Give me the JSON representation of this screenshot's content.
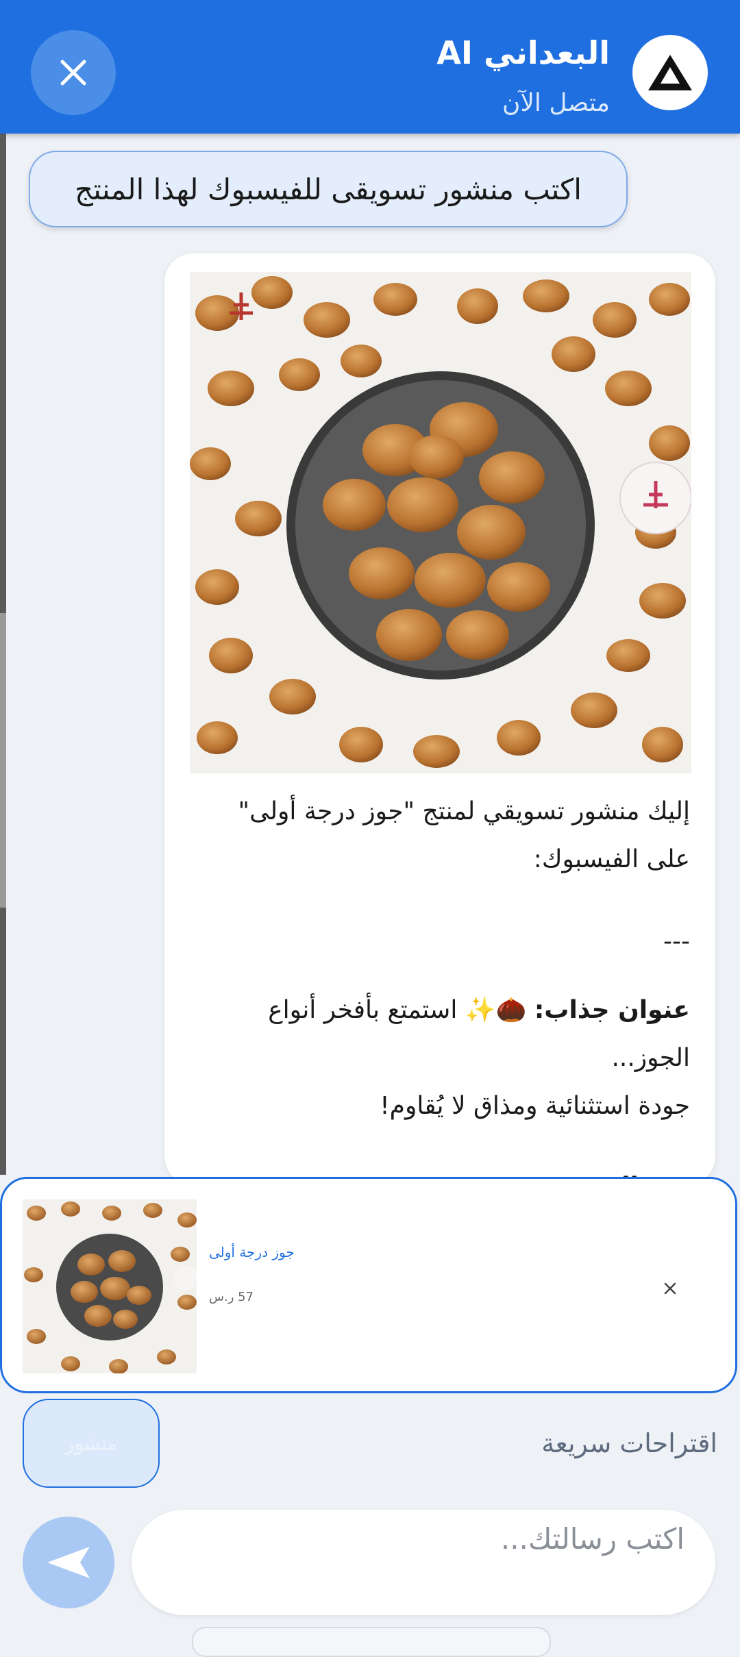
{
  "header": {
    "title": "البعداني AI",
    "status": "متصل الآن"
  },
  "user_message": "اكتب منشور تسويقى للفيسبوك لهذا المنتج",
  "bot_message": {
    "line1": "إليك منشور تسويقي لمنتج \"جوز درجة أولى\"",
    "line2": "على الفيسبوك:",
    "separator": "---",
    "headline_label": "عنوان جذاب:",
    "headline_text": "🌰✨ استمتع بأفخر أنواع الجوز...",
    "headline_line2": "جودة استثنائية ومذاق لا يُقاوم!",
    "body_label": "نص المنشور:"
  },
  "product_context": {
    "name": "جوز درجة أولى",
    "price": "57 ر.س"
  },
  "quick_suggestions": {
    "label": "اقتراحات سريعة",
    "chip": "منشور"
  },
  "composer": {
    "placeholder": "اكتب رسالتك..."
  }
}
